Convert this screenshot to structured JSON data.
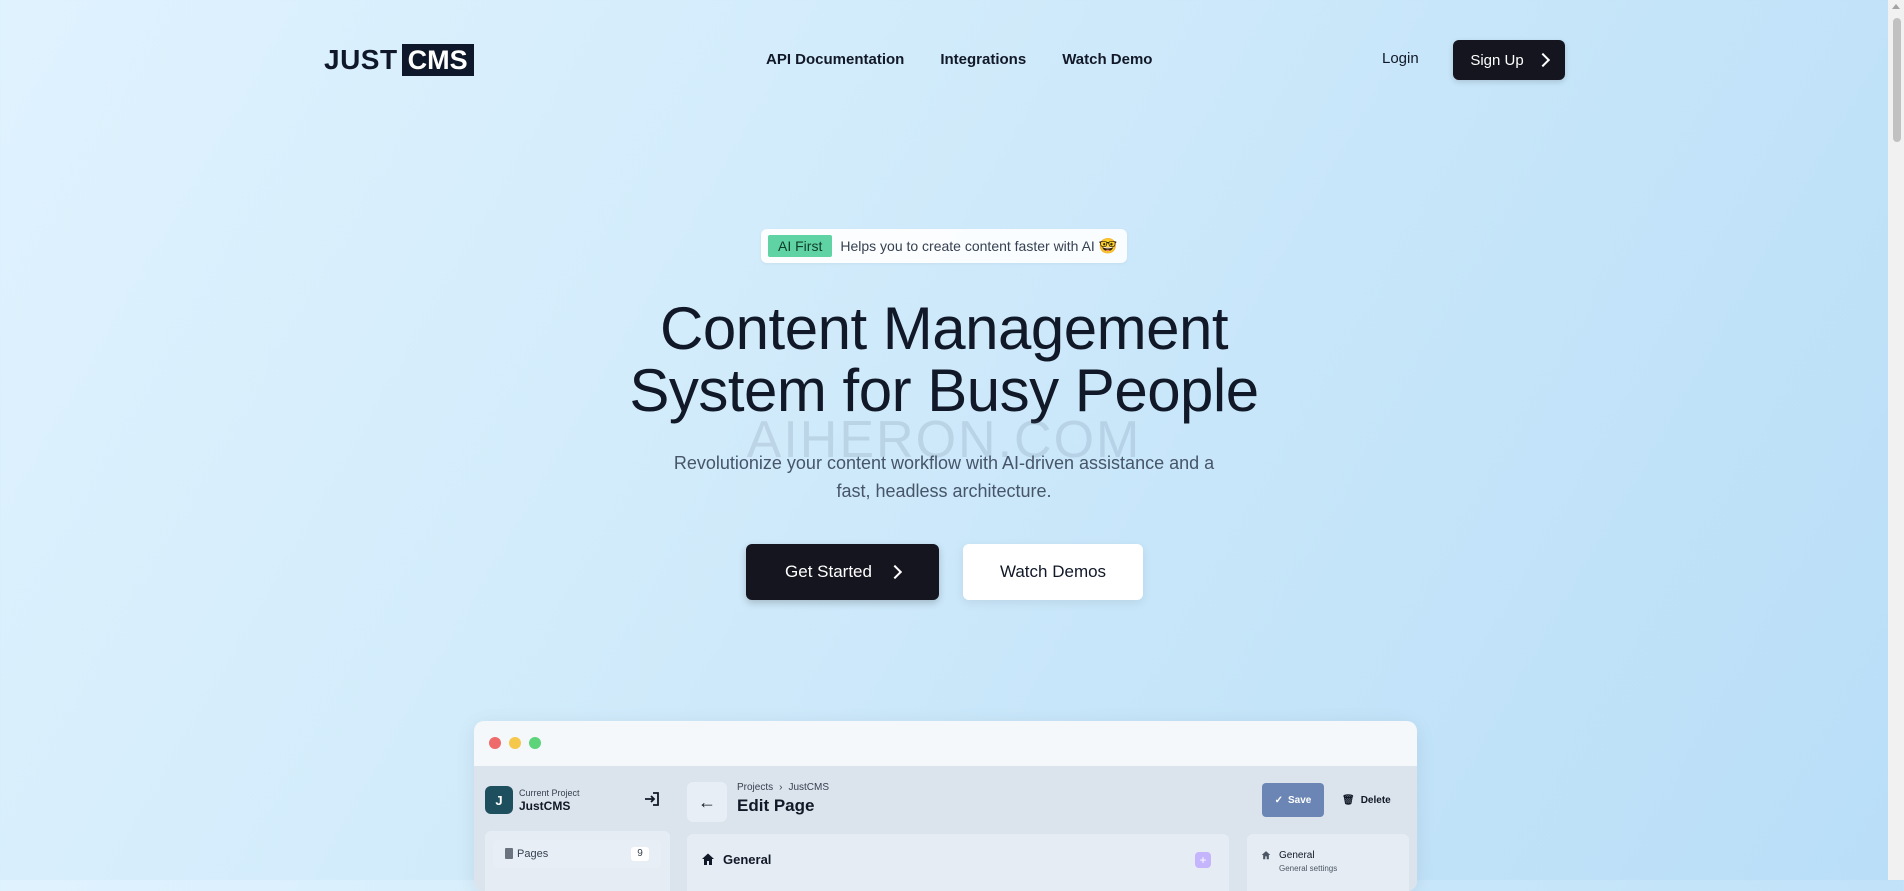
{
  "header": {
    "logo_just": "JUST",
    "logo_cms": "CMS",
    "nav": [
      "API Documentation",
      "Integrations",
      "Watch Demo"
    ],
    "login": "Login",
    "signup": "Sign Up"
  },
  "hero": {
    "badge_tag": "AI First",
    "badge_text": "Helps you to create content faster with AI",
    "badge_emoji": "🤓",
    "headline_line1": "Content Management",
    "headline_line2": "System for Busy People",
    "watermark": "AIHERON.COM",
    "subhead": "Revolutionize your content workflow with AI-driven assistance and a fast, headless architecture.",
    "cta_primary": "Get Started",
    "cta_secondary": "Watch Demos"
  },
  "preview": {
    "window_dots": [
      "#ef6b6b",
      "#f5c84c",
      "#5dd37a"
    ],
    "project_avatar": "J",
    "project_caption": "Current Project",
    "project_name": "JustCMS",
    "sidebar_pages_label": "Pages",
    "sidebar_pages_count": "9",
    "breadcrumb": [
      "Projects",
      "JustCMS"
    ],
    "page_title": "Edit Page",
    "save_label": "Save",
    "delete_label": "Delete",
    "section_title": "General",
    "right_panel_title": "General",
    "right_panel_sub": "General settings"
  },
  "colors": {
    "primary_dark": "#14151f",
    "badge_green": "#5fd3a3",
    "save_blue": "#6b86b4"
  }
}
